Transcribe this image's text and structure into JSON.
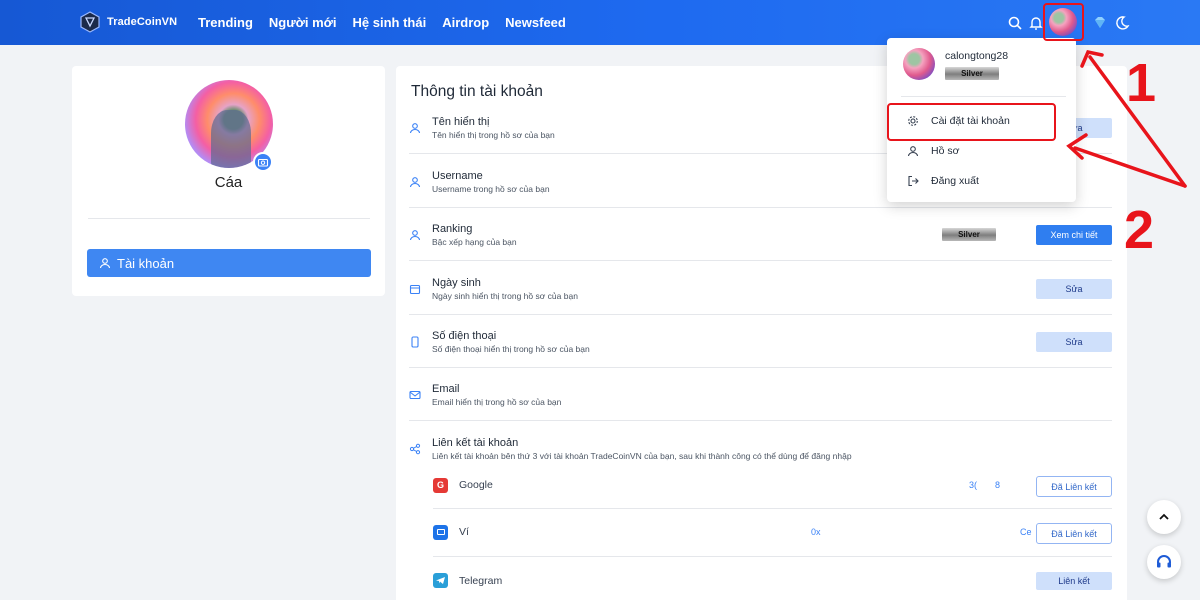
{
  "header": {
    "brand": "TradeCoinVN",
    "nav": [
      "Trending",
      "Người mới",
      "Hệ sinh thái",
      "Airdrop",
      "Newsfeed"
    ]
  },
  "sidebar": {
    "name": "Cáa",
    "account_button": "Tài khoản"
  },
  "main": {
    "title": "Thông tin tài khoản",
    "rows": [
      {
        "label": "Tên hiển thị",
        "sub": "Tên hiển thị trong hồ sơ của bạn",
        "button": "Sửa"
      },
      {
        "label": "Username",
        "sub": "Username trong hồ sơ của bạn"
      },
      {
        "label": "Ranking",
        "sub": "Bậc xếp hạng của bạn",
        "badge": "Silver",
        "button": "Xem chi tiết"
      },
      {
        "label": "Ngày sinh",
        "sub": "Ngày sinh hiển thị trong hồ sơ của bạn",
        "button": "Sửa"
      },
      {
        "label": "Số điện thoại",
        "sub": "Số điện thoại hiển thị trong hồ sơ của bạn",
        "button": "Sửa"
      },
      {
        "label": "Email",
        "sub": "Email hiển thị trong hồ sơ của bạn"
      },
      {
        "label": "Liên kết tài khoản",
        "sub": "Liên kết tài khoản bên thứ 3 với tài khoản TradeCoinVN của bạn, sau khi thành công có thể dùng để đăng nhập"
      }
    ],
    "links": [
      {
        "name": "Google",
        "value_a": "3(",
        "value_b": "8",
        "button": "Đã Liên kết"
      },
      {
        "name": "Ví",
        "value_a": "0x",
        "value_b": "Ce",
        "button": "Đã Liên kết"
      },
      {
        "name": "Telegram",
        "button": "Liên kết"
      }
    ]
  },
  "dropdown": {
    "username": "calongtong28",
    "rank": "Silver",
    "items": [
      "Cài đặt tài khoản",
      "Hồ sơ",
      "Đăng xuất"
    ]
  },
  "annotations": {
    "one": "1",
    "two": "2"
  },
  "colors": {
    "primary": "#1e6af0",
    "annotation": "#e8141b"
  }
}
